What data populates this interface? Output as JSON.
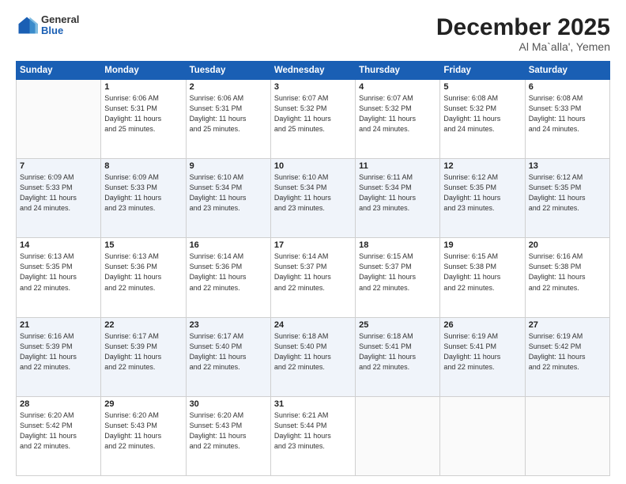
{
  "header": {
    "logo": {
      "general": "General",
      "blue": "Blue"
    },
    "title": "December 2025",
    "subtitle": "Al Ma`alla', Yemen"
  },
  "calendar": {
    "days_of_week": [
      "Sunday",
      "Monday",
      "Tuesday",
      "Wednesday",
      "Thursday",
      "Friday",
      "Saturday"
    ],
    "weeks": [
      [
        {
          "day": "",
          "info": ""
        },
        {
          "day": "1",
          "info": "Sunrise: 6:06 AM\nSunset: 5:31 PM\nDaylight: 11 hours\nand 25 minutes."
        },
        {
          "day": "2",
          "info": "Sunrise: 6:06 AM\nSunset: 5:31 PM\nDaylight: 11 hours\nand 25 minutes."
        },
        {
          "day": "3",
          "info": "Sunrise: 6:07 AM\nSunset: 5:32 PM\nDaylight: 11 hours\nand 25 minutes."
        },
        {
          "day": "4",
          "info": "Sunrise: 6:07 AM\nSunset: 5:32 PM\nDaylight: 11 hours\nand 24 minutes."
        },
        {
          "day": "5",
          "info": "Sunrise: 6:08 AM\nSunset: 5:32 PM\nDaylight: 11 hours\nand 24 minutes."
        },
        {
          "day": "6",
          "info": "Sunrise: 6:08 AM\nSunset: 5:33 PM\nDaylight: 11 hours\nand 24 minutes."
        }
      ],
      [
        {
          "day": "7",
          "info": "Sunrise: 6:09 AM\nSunset: 5:33 PM\nDaylight: 11 hours\nand 24 minutes."
        },
        {
          "day": "8",
          "info": "Sunrise: 6:09 AM\nSunset: 5:33 PM\nDaylight: 11 hours\nand 23 minutes."
        },
        {
          "day": "9",
          "info": "Sunrise: 6:10 AM\nSunset: 5:34 PM\nDaylight: 11 hours\nand 23 minutes."
        },
        {
          "day": "10",
          "info": "Sunrise: 6:10 AM\nSunset: 5:34 PM\nDaylight: 11 hours\nand 23 minutes."
        },
        {
          "day": "11",
          "info": "Sunrise: 6:11 AM\nSunset: 5:34 PM\nDaylight: 11 hours\nand 23 minutes."
        },
        {
          "day": "12",
          "info": "Sunrise: 6:12 AM\nSunset: 5:35 PM\nDaylight: 11 hours\nand 23 minutes."
        },
        {
          "day": "13",
          "info": "Sunrise: 6:12 AM\nSunset: 5:35 PM\nDaylight: 11 hours\nand 22 minutes."
        }
      ],
      [
        {
          "day": "14",
          "info": "Sunrise: 6:13 AM\nSunset: 5:35 PM\nDaylight: 11 hours\nand 22 minutes."
        },
        {
          "day": "15",
          "info": "Sunrise: 6:13 AM\nSunset: 5:36 PM\nDaylight: 11 hours\nand 22 minutes."
        },
        {
          "day": "16",
          "info": "Sunrise: 6:14 AM\nSunset: 5:36 PM\nDaylight: 11 hours\nand 22 minutes."
        },
        {
          "day": "17",
          "info": "Sunrise: 6:14 AM\nSunset: 5:37 PM\nDaylight: 11 hours\nand 22 minutes."
        },
        {
          "day": "18",
          "info": "Sunrise: 6:15 AM\nSunset: 5:37 PM\nDaylight: 11 hours\nand 22 minutes."
        },
        {
          "day": "19",
          "info": "Sunrise: 6:15 AM\nSunset: 5:38 PM\nDaylight: 11 hours\nand 22 minutes."
        },
        {
          "day": "20",
          "info": "Sunrise: 6:16 AM\nSunset: 5:38 PM\nDaylight: 11 hours\nand 22 minutes."
        }
      ],
      [
        {
          "day": "21",
          "info": "Sunrise: 6:16 AM\nSunset: 5:39 PM\nDaylight: 11 hours\nand 22 minutes."
        },
        {
          "day": "22",
          "info": "Sunrise: 6:17 AM\nSunset: 5:39 PM\nDaylight: 11 hours\nand 22 minutes."
        },
        {
          "day": "23",
          "info": "Sunrise: 6:17 AM\nSunset: 5:40 PM\nDaylight: 11 hours\nand 22 minutes."
        },
        {
          "day": "24",
          "info": "Sunrise: 6:18 AM\nSunset: 5:40 PM\nDaylight: 11 hours\nand 22 minutes."
        },
        {
          "day": "25",
          "info": "Sunrise: 6:18 AM\nSunset: 5:41 PM\nDaylight: 11 hours\nand 22 minutes."
        },
        {
          "day": "26",
          "info": "Sunrise: 6:19 AM\nSunset: 5:41 PM\nDaylight: 11 hours\nand 22 minutes."
        },
        {
          "day": "27",
          "info": "Sunrise: 6:19 AM\nSunset: 5:42 PM\nDaylight: 11 hours\nand 22 minutes."
        }
      ],
      [
        {
          "day": "28",
          "info": "Sunrise: 6:20 AM\nSunset: 5:42 PM\nDaylight: 11 hours\nand 22 minutes."
        },
        {
          "day": "29",
          "info": "Sunrise: 6:20 AM\nSunset: 5:43 PM\nDaylight: 11 hours\nand 22 minutes."
        },
        {
          "day": "30",
          "info": "Sunrise: 6:20 AM\nSunset: 5:43 PM\nDaylight: 11 hours\nand 22 minutes."
        },
        {
          "day": "31",
          "info": "Sunrise: 6:21 AM\nSunset: 5:44 PM\nDaylight: 11 hours\nand 23 minutes."
        },
        {
          "day": "",
          "info": ""
        },
        {
          "day": "",
          "info": ""
        },
        {
          "day": "",
          "info": ""
        }
      ]
    ]
  }
}
